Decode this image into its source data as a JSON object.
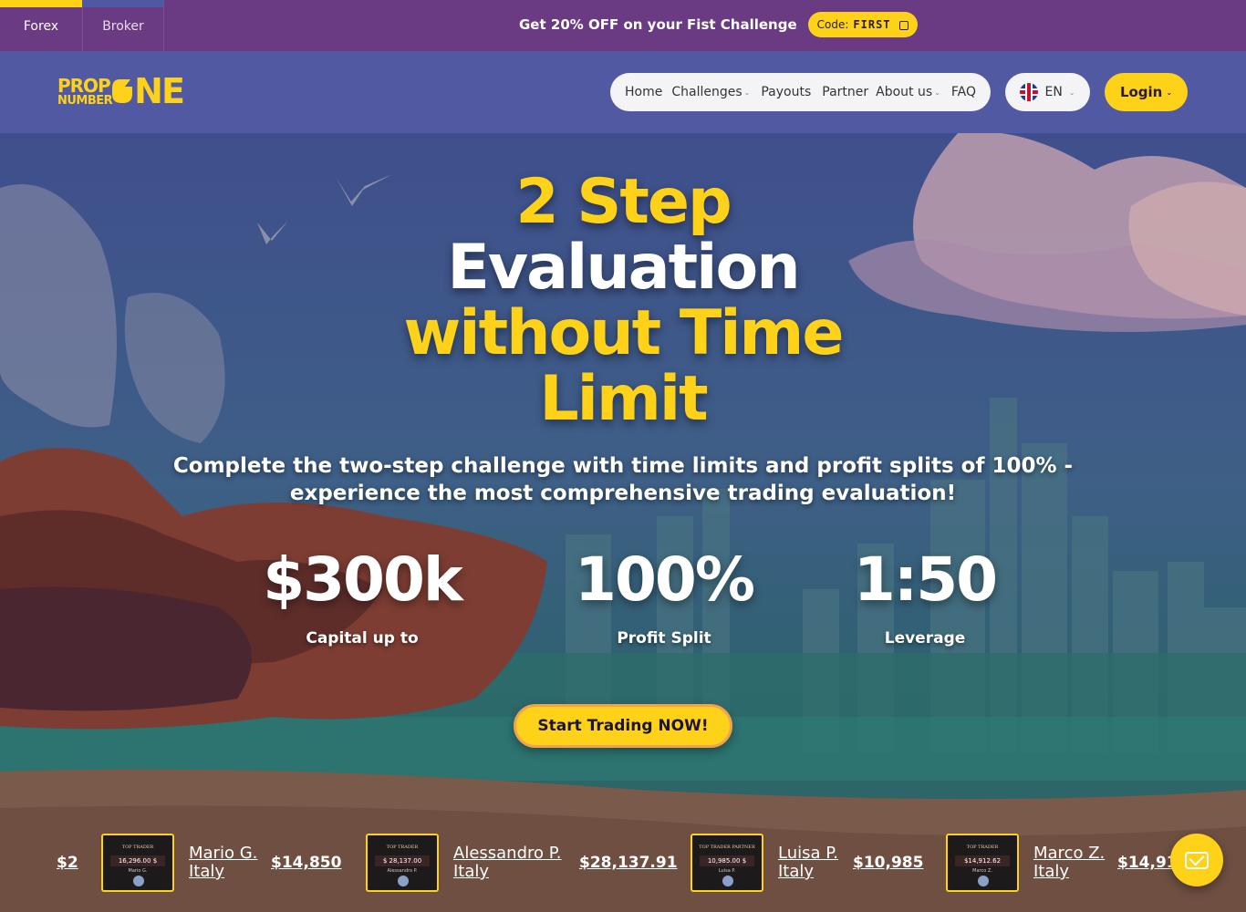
{
  "promo": {
    "tabs": [
      "Forex",
      "Broker"
    ],
    "text": "Get 20% OFF on your Fist Challenge",
    "code_label": "Code:",
    "code_value": "FIRST"
  },
  "header": {
    "logo": {
      "line1": "PROP",
      "line2": "NUMBER",
      "big": "NE"
    },
    "nav": [
      "Home",
      "Challenges",
      "Payouts",
      "Partner",
      "About us",
      "FAQ"
    ],
    "language": "EN",
    "login": "Login"
  },
  "hero": {
    "headline": [
      "2 Step",
      "Evaluation",
      "without Time",
      "Limit"
    ],
    "subtitle": "Complete the two-step challenge with time limits and profit splits of 100% - experience the most comprehensive trading evaluation!",
    "stats": [
      {
        "value": "$300k",
        "label": "Capital up to"
      },
      {
        "value": "100%",
        "label": "Profit Split"
      },
      {
        "value": "1:50",
        "label": "Leverage"
      }
    ],
    "cta": "Start Trading NOW!"
  },
  "ticker": {
    "cut_amount": "$2",
    "items": [
      {
        "name": "Mario G.",
        "country": "Italy",
        "amount": "$14,850",
        "cert_title": "TOP TRADER",
        "cert_amount": "16,296.00 $",
        "cert_name": "Mario G."
      },
      {
        "name": "Alessandro P.",
        "country": "Italy",
        "amount": "$28,137.91",
        "cert_title": "TOP TRADER",
        "cert_amount": "$ 28,137.00",
        "cert_name": "Alessandro P."
      },
      {
        "name": "Luisa P.",
        "country": "Italy",
        "amount": "$10,985",
        "cert_title": "TOP TRADER PARTNER",
        "cert_amount": "10,985.00 $",
        "cert_name": "Luisa P."
      },
      {
        "name": "Marco Z.",
        "country": "Italy",
        "amount": "$14,912",
        "cert_title": "TOP TRADER",
        "cert_amount": "$14,912.62",
        "cert_name": "Marco Z."
      }
    ]
  },
  "icons": {
    "copy": "copy-icon",
    "chevron": "chevron-down-icon",
    "flag": "uk-flag-icon",
    "chat": "mail-icon"
  },
  "colors": {
    "brand_yellow": "#ffd21a",
    "promo_bg": "#6a3a82",
    "header_bg": "#5159a3"
  }
}
